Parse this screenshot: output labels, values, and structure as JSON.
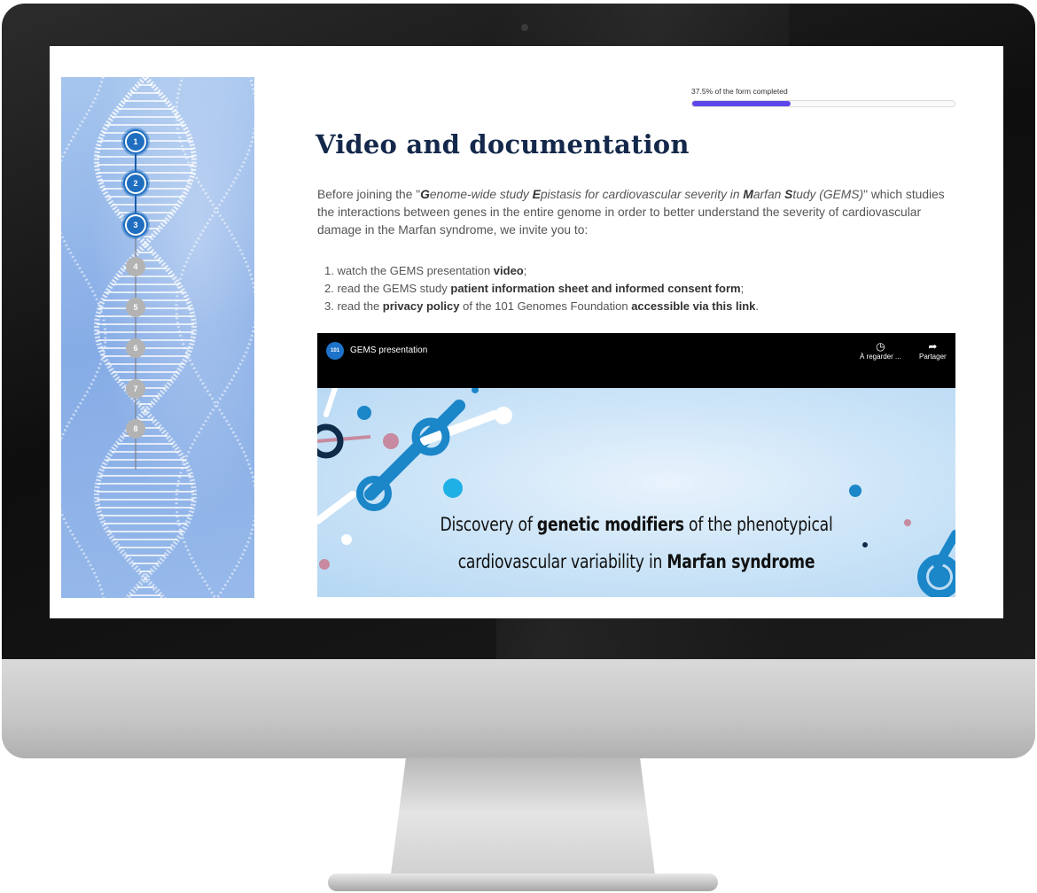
{
  "form": {
    "progress_label": "37.5% of the form completed",
    "progress_fraction": 0.375
  },
  "steps": [
    {
      "label": "1",
      "state": "done"
    },
    {
      "label": "2",
      "state": "done"
    },
    {
      "label": "3",
      "state": "done"
    },
    {
      "label": "4",
      "state": "todo"
    },
    {
      "label": "5",
      "state": "todo"
    },
    {
      "label": "6",
      "state": "todo"
    },
    {
      "label": "7",
      "state": "todo"
    },
    {
      "label": "8",
      "state": "todo"
    }
  ],
  "page": {
    "title": "Video and documentation",
    "intro": {
      "before": "Before joining the \"",
      "g": "G",
      "enome": "enome-wide study ",
      "e": "E",
      "pistasis": "pistasis for cardiovascular severity in ",
      "m": "M",
      "arfan": "arfan ",
      "s": "S",
      "tudy": "tudy (GEMS)",
      "after": "\" which studies the interactions between genes in the entire genome in order to better understand the severity of cardiovascular damage in the Marfan syndrome, we invite you to:"
    },
    "list": [
      {
        "num": "1.",
        "pre": "watch the GEMS presentation ",
        "bold": "video",
        "post": ";",
        "mid": "",
        "bold2": ""
      },
      {
        "num": "2.",
        "pre": "read the GEMS study ",
        "bold": "patient information sheet and informed consent form",
        "post": ";",
        "mid": "",
        "bold2": ""
      },
      {
        "num": "3.",
        "pre": "read the ",
        "bold": "privacy policy",
        "mid": " of the 101 Genomes Foundation ",
        "bold2": "accessible via this link",
        "post": "."
      }
    ]
  },
  "video": {
    "title": "GEMS presentation",
    "channel_badge": "101",
    "watch_later_label": "À regarder ...",
    "share_label": "Partager",
    "caption_line1_pre": "Discovery of ",
    "caption_line1_bold": "genetic modifiers",
    "caption_line1_post": " of the phenotypical",
    "caption_line2_pre": "cardiovascular variability in ",
    "caption_line2_bold": "Marfan syndrome"
  },
  "colors": {
    "accent": "#5e47ea",
    "title": "#13284a",
    "step_done": "#1f6ec0",
    "step_todo": "#b3b3b3"
  }
}
